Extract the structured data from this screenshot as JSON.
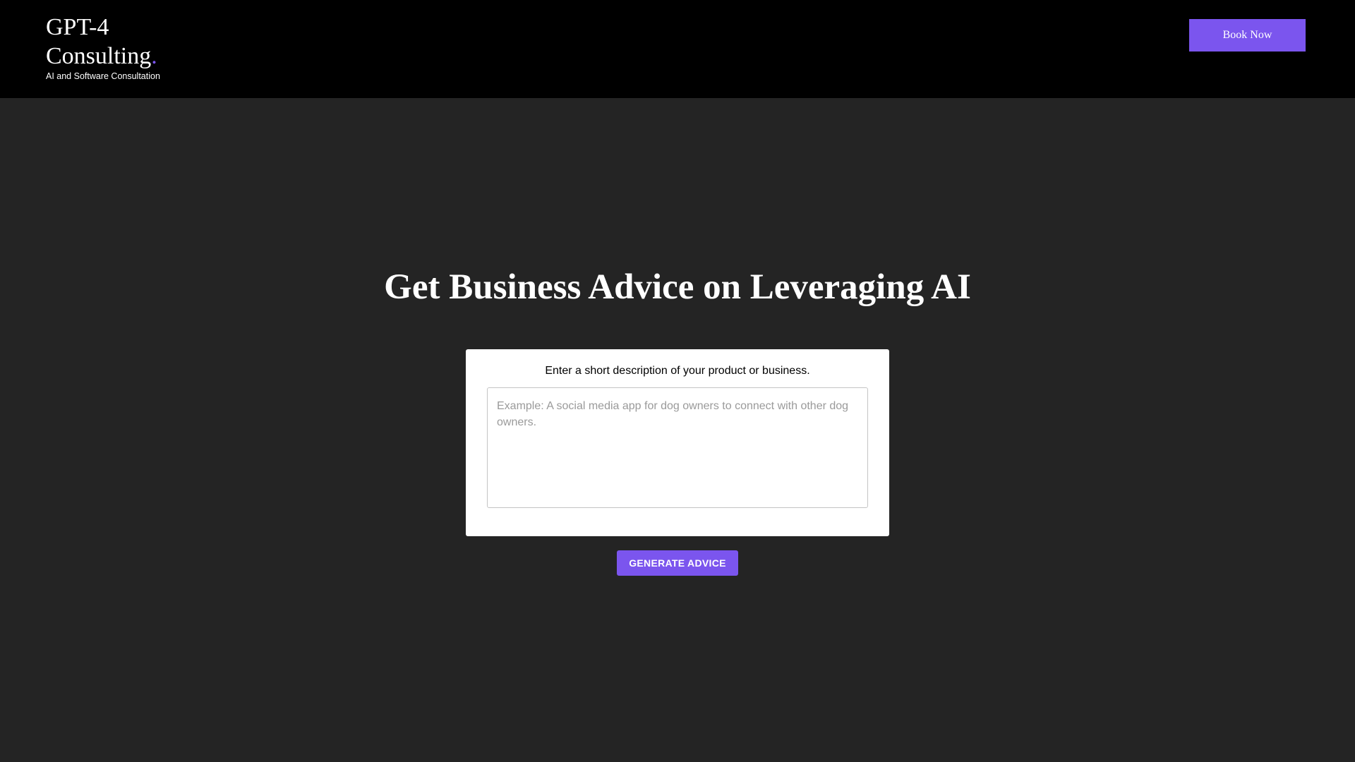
{
  "header": {
    "brand_line1": "GPT-4",
    "brand_line2": "Consulting",
    "brand_dot": ".",
    "tagline": "AI and Software Consultation",
    "book_button_label": "Book Now"
  },
  "main": {
    "headline": "Get Business Advice on Leveraging AI",
    "form": {
      "label": "Enter a short description of your product or business.",
      "textarea_value": "",
      "textarea_placeholder": "Example: A social media app for dog owners to connect with other dog owners."
    },
    "generate_button_label": "GENERATE ADVICE"
  },
  "colors": {
    "accent": "#7b55ee",
    "header_bg": "#000000",
    "page_bg": "#242424",
    "card_bg": "#ffffff"
  }
}
